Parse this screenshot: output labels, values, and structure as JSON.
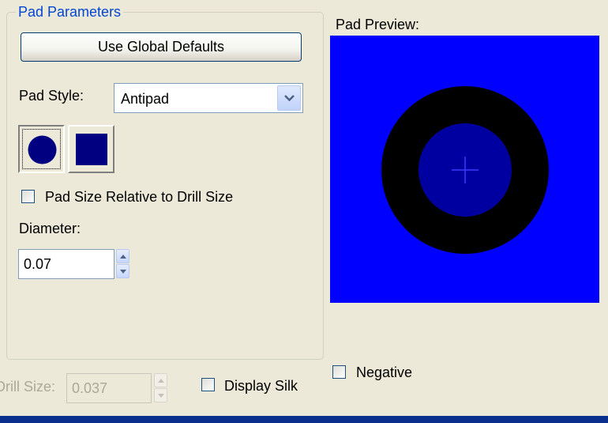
{
  "pad_parameters": {
    "group_title": "Pad Parameters",
    "use_global_defaults_label": "Use Global Defaults",
    "pad_style_label": "Pad Style:",
    "pad_style_value": "Antipad",
    "shape_options": [
      "circle",
      "square"
    ],
    "selected_shape": "circle",
    "relative_checkbox_label": "Pad Size Relative to Drill Size",
    "relative_checked": false,
    "diameter_label": "Diameter:",
    "diameter_value": "0.07"
  },
  "preview": {
    "label": "Pad Preview:",
    "background_color": "#0000ff",
    "pad_ring_color": "#000000",
    "drill_color": "#0000a0",
    "crosshair_color": "#3a3aff"
  },
  "bottom": {
    "drill_size_label": "Drill Size:",
    "drill_size_value": "0.037",
    "display_silk_label": "Display Silk",
    "display_silk_checked": false,
    "negative_label": "Negative",
    "negative_checked": false
  },
  "colors": {
    "group_title": "#0046d5",
    "shape_fill": "#000080"
  }
}
